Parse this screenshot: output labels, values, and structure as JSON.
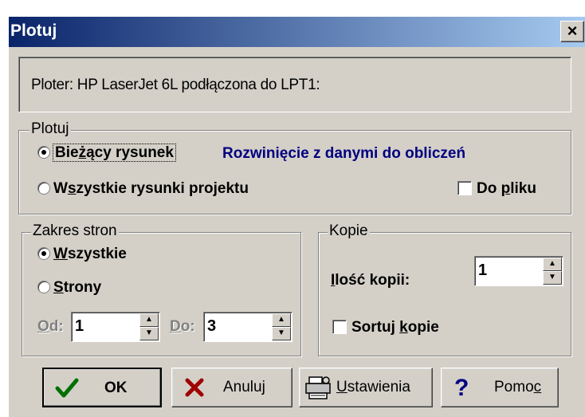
{
  "window": {
    "title": "Plotuj",
    "close_label": "×"
  },
  "info": {
    "plotter_line": "Ploter: HP LaserJet 6L podłączona do LPT1:"
  },
  "plot_group": {
    "legend": "Plotuj",
    "option_current_pre": "Bie",
    "option_current_u": "ż",
    "option_current_post": "ący rysunek",
    "current_drawing_name": "Rozwinięcie z danymi do obliczeń",
    "option_all_pre": "W",
    "option_all_u": "s",
    "option_all_post": "zystkie rysunki projektu",
    "to_file_pre": "Do ",
    "to_file_u": "p",
    "to_file_post": "liku",
    "selected": "current",
    "to_file_checked": false
  },
  "pages_group": {
    "legend": "Zakres stron",
    "all_u": "W",
    "all_post": "szystkie",
    "pages_u": "S",
    "pages_post": "trony",
    "from_u": "O",
    "from_post": "d:",
    "from_value": "1",
    "to_u": "D",
    "to_post": "o:",
    "to_value": "3",
    "selected": "all"
  },
  "copies_group": {
    "legend": "Kopie",
    "count_u": "I",
    "count_post": "lość kopii:",
    "count_value": "1",
    "collate_pre": "Sortuj ",
    "collate_u": "k",
    "collate_post": "opie",
    "collate_checked": false
  },
  "buttons": {
    "ok": "OK",
    "cancel": "Anuluj",
    "settings_u": "U",
    "settings_post": "stawienia",
    "help_pre": "Pomo",
    "help_u": "c"
  },
  "colors": {
    "title_start": "#0a246a",
    "title_end": "#a6caf0",
    "face": "#d4d0c8",
    "highlight_text": "#000080"
  },
  "icons": [
    "close-icon",
    "checkmark-icon",
    "x-icon",
    "printer-icon",
    "question-icon",
    "spin-up-icon",
    "spin-down-icon"
  ]
}
